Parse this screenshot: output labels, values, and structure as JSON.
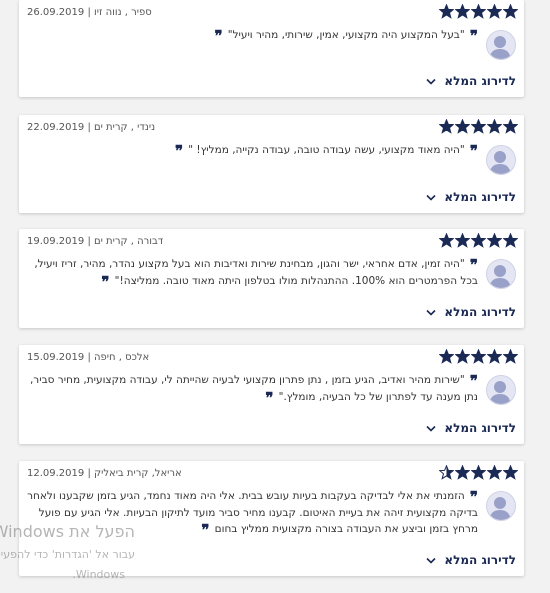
{
  "colors": {
    "star": "#1b2a55",
    "accent": "#1b2a55"
  },
  "reviews": [
    {
      "stars": 5,
      "meta": "ספיר , נווה זיו | 26.09.2019",
      "quote": "\"בעל המקצוע היה מקצועי, אמין, שירותי, מהיר ויעיל\"",
      "more": "לדירוג המלא"
    },
    {
      "stars": 5,
      "meta": "נינדי , קרית ים | 22.09.2019",
      "quote": "\"היה מאוד מקצועי, עשה עבודה טובה, עבודה נקייה, ממליץ! \"",
      "more": "לדירוג המלא"
    },
    {
      "stars": 5,
      "meta": "דבורה , קרית ים | 19.09.2019",
      "quote": "\"היה זמין, אדם אחראי, ישר והגון, מבחינת שירות ואדיבות הוא בעל מקצוע נהדר, מהיר, זריז ויעיל, בכל הפרמטרים הוא 100%. ההתנהלות מולו בטלפון היתה מאוד טובה. ממליצה!\"",
      "more": "לדירוג המלא"
    },
    {
      "stars": 5,
      "meta": "אלכס , חיפה | 15.09.2019",
      "quote": "\"שירות מהיר ואדיב, הגיע בזמן , נתן פתרון מקצועי לבעיה שהייתה לי, עבודה מקצועית, מחיר סביר, נתן מענה עד לפתרון של כל הבעיה, מומלץ.\"",
      "more": "לדירוג המלא"
    },
    {
      "stars": 4.5,
      "meta": "אריאל, קרית ביאליק | 12.09.2019",
      "quote": "הזמנתי את אלי לבדיקה בעקבות בעיות עובש בבית. אלי היה מאוד נחמד, הגיע בזמן שקבענו ולאחר בדיקה מקצועית זיהה את בעיית האיטום. קבענו מחיר סביר מועד לתיקון הבעיות. אלי הגיע עם פועל מרחץ בזמן וביצע את העבודה בצורה מקצועית ממליץ בחום",
      "more": "לדירוג המלא"
    }
  ],
  "watermark": {
    "title": "הפעל את Windows",
    "line1": "עבור אל 'הגדרות' כדי להפעיל את",
    "line2": ".Windows"
  }
}
